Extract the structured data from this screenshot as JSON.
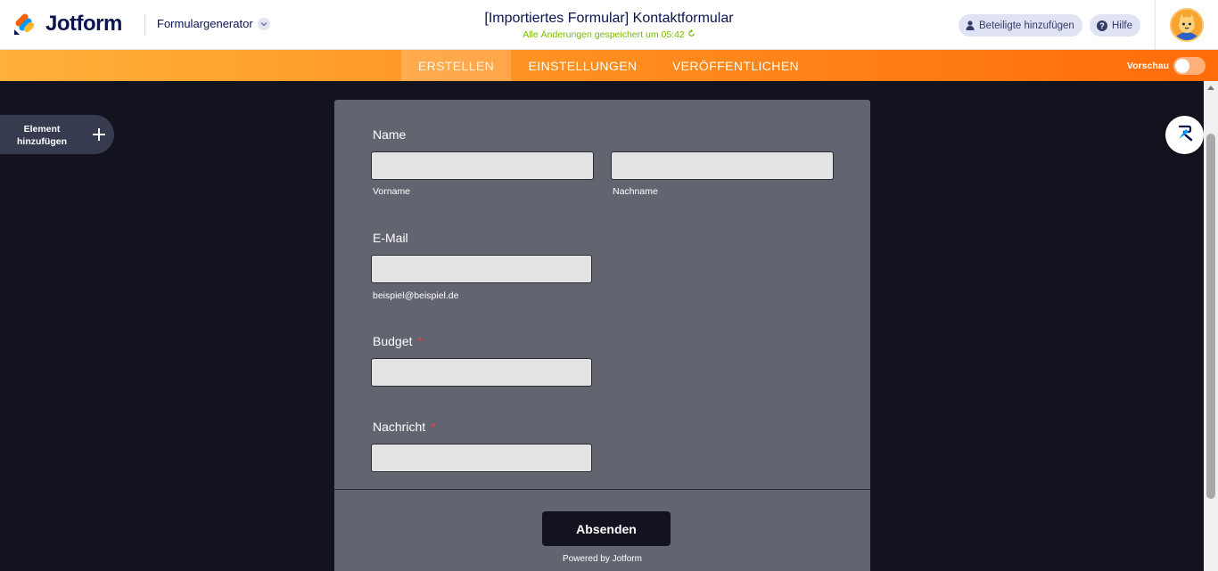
{
  "header": {
    "logo_text": "Jotform",
    "generator_label": "Formulargenerator",
    "form_title": "[Importiertes Formular] Kontaktformular",
    "saved_status": "Alle Änderungen gespeichert um 05:42",
    "collab_label": "Beteiligte hinzufügen",
    "help_label": "Hilfe"
  },
  "nav": {
    "tabs": [
      {
        "label": "ERSTELLEN",
        "active": true
      },
      {
        "label": "EINSTELLUNGEN",
        "active": false
      },
      {
        "label": "VERÖFFENTLICHEN",
        "active": false
      }
    ],
    "preview_label": "Vorschau",
    "preview_on": false
  },
  "sidebar": {
    "add_element_line1": "Element",
    "add_element_line2": "hinzufügen"
  },
  "form": {
    "name_label": "Name",
    "first_name_sub": "Vorname",
    "last_name_sub": "Nachname",
    "email_label": "E-Mail",
    "email_sub": "beispiel@beispiel.de",
    "budget_label": "Budget",
    "message_label": "Nachricht",
    "required_mark": "*",
    "submit_label": "Absenden",
    "powered_by": "Powered by Jotform"
  },
  "colors": {
    "brand_navy": "#0a1551",
    "accent_orange": "#ff6c0a",
    "saved_green": "#78bb07",
    "form_bg": "#62656f",
    "canvas_bg": "#13131f"
  },
  "icons": {
    "logo": "jotform-logo-icon",
    "generator_chevron": "chevron-down-icon",
    "saved": "refresh-icon",
    "collab": "user-icon",
    "help": "question-icon",
    "avatar": "user-avatar",
    "add": "plus-icon",
    "designer": "paint-roller-icon"
  }
}
